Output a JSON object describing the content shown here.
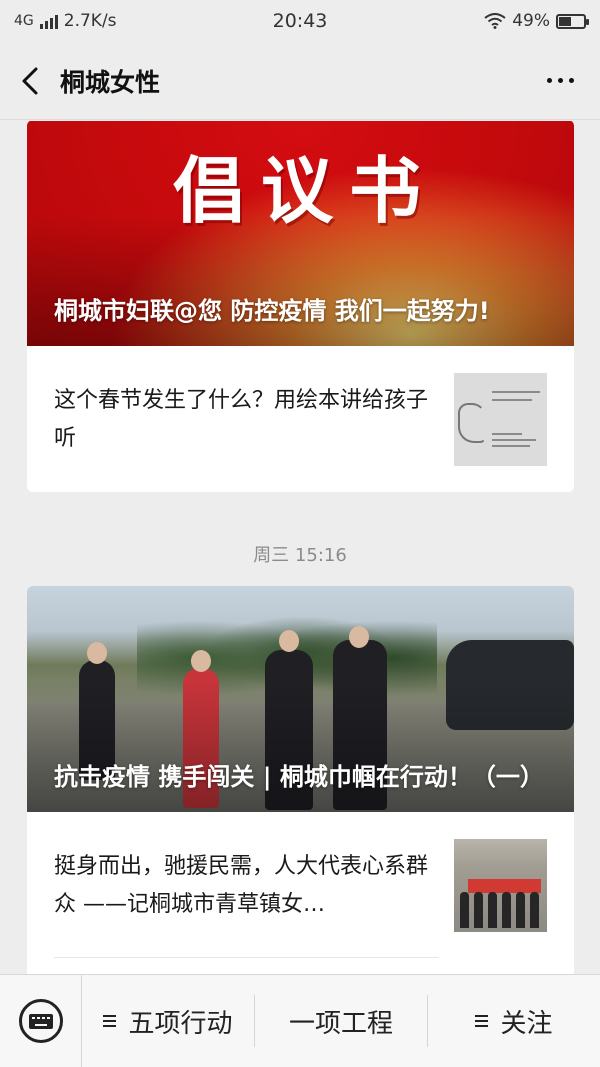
{
  "status_bar": {
    "network": "4G",
    "speed": "2.7K/s",
    "time": "20:43",
    "battery_percent": "49%",
    "battery_level": 0.49,
    "icons": [
      "signal-icon",
      "wifi-icon",
      "battery-icon"
    ]
  },
  "header": {
    "title": "桐城女性",
    "back_icon": "chevron-left-icon",
    "more_icon": "more-dots-icon"
  },
  "feed": {
    "groups": [
      {
        "cover": {
          "banner_text": "倡议书",
          "title": "桐城市妇联@您 防控疫情 我们一起努力!"
        },
        "articles": [
          {
            "title": "这个春节发生了什么？用绘本讲给孩子听",
            "thumb_caption": "2020，这个春节发生了什么？"
          }
        ]
      },
      {
        "timestamp": "周三 15:16",
        "cover": {
          "title": "抗击疫情 携手闯关 | 桐城巾帼在行动！（一）"
        },
        "articles": [
          {
            "title": "挺身而出，驰援民需，人大代表心系群众 ——记桐城市青草镇女…"
          }
        ]
      }
    ]
  },
  "bottom_menu": {
    "keyboard_icon": "keyboard-icon",
    "items": [
      {
        "label": "五项行动",
        "has_menu_icon": true
      },
      {
        "label": "一项工程",
        "has_menu_icon": false
      },
      {
        "label": "关注",
        "has_menu_icon": true
      }
    ]
  }
}
